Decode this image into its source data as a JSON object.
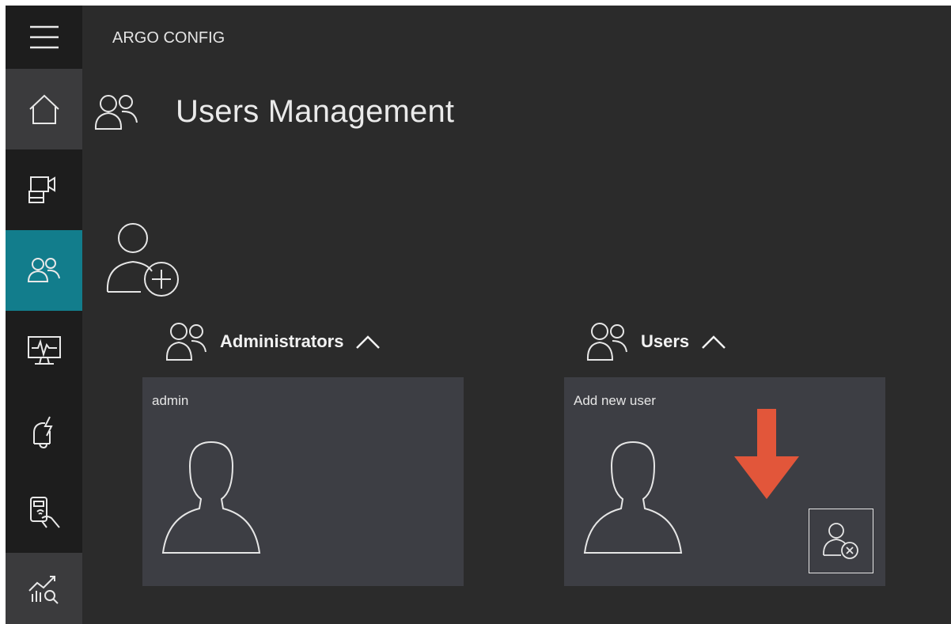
{
  "app": {
    "title": "ARGO CONFIG"
  },
  "page": {
    "title": "Users Management"
  },
  "sidebar": {
    "items": [
      {
        "id": "menu",
        "icon": "hamburger-menu-icon"
      },
      {
        "id": "home",
        "icon": "home-icon"
      },
      {
        "id": "cameras",
        "icon": "camera-recorder-icon"
      },
      {
        "id": "users",
        "icon": "users-icon",
        "active": true
      },
      {
        "id": "monitoring",
        "icon": "monitor-pulse-icon"
      },
      {
        "id": "alarms",
        "icon": "alarm-bell-icon"
      },
      {
        "id": "access",
        "icon": "access-card-icon"
      },
      {
        "id": "statistics",
        "icon": "statistics-icon"
      }
    ]
  },
  "groups": [
    {
      "label": "Administrators",
      "cards": [
        {
          "name": "admin"
        }
      ]
    },
    {
      "label": "Users",
      "cards": [
        {
          "name": "Add new user"
        }
      ]
    }
  ],
  "colors": {
    "sidebar_active": "#127d8c",
    "card_bg": "#3d3e44",
    "annotation_arrow": "#e2563a"
  }
}
